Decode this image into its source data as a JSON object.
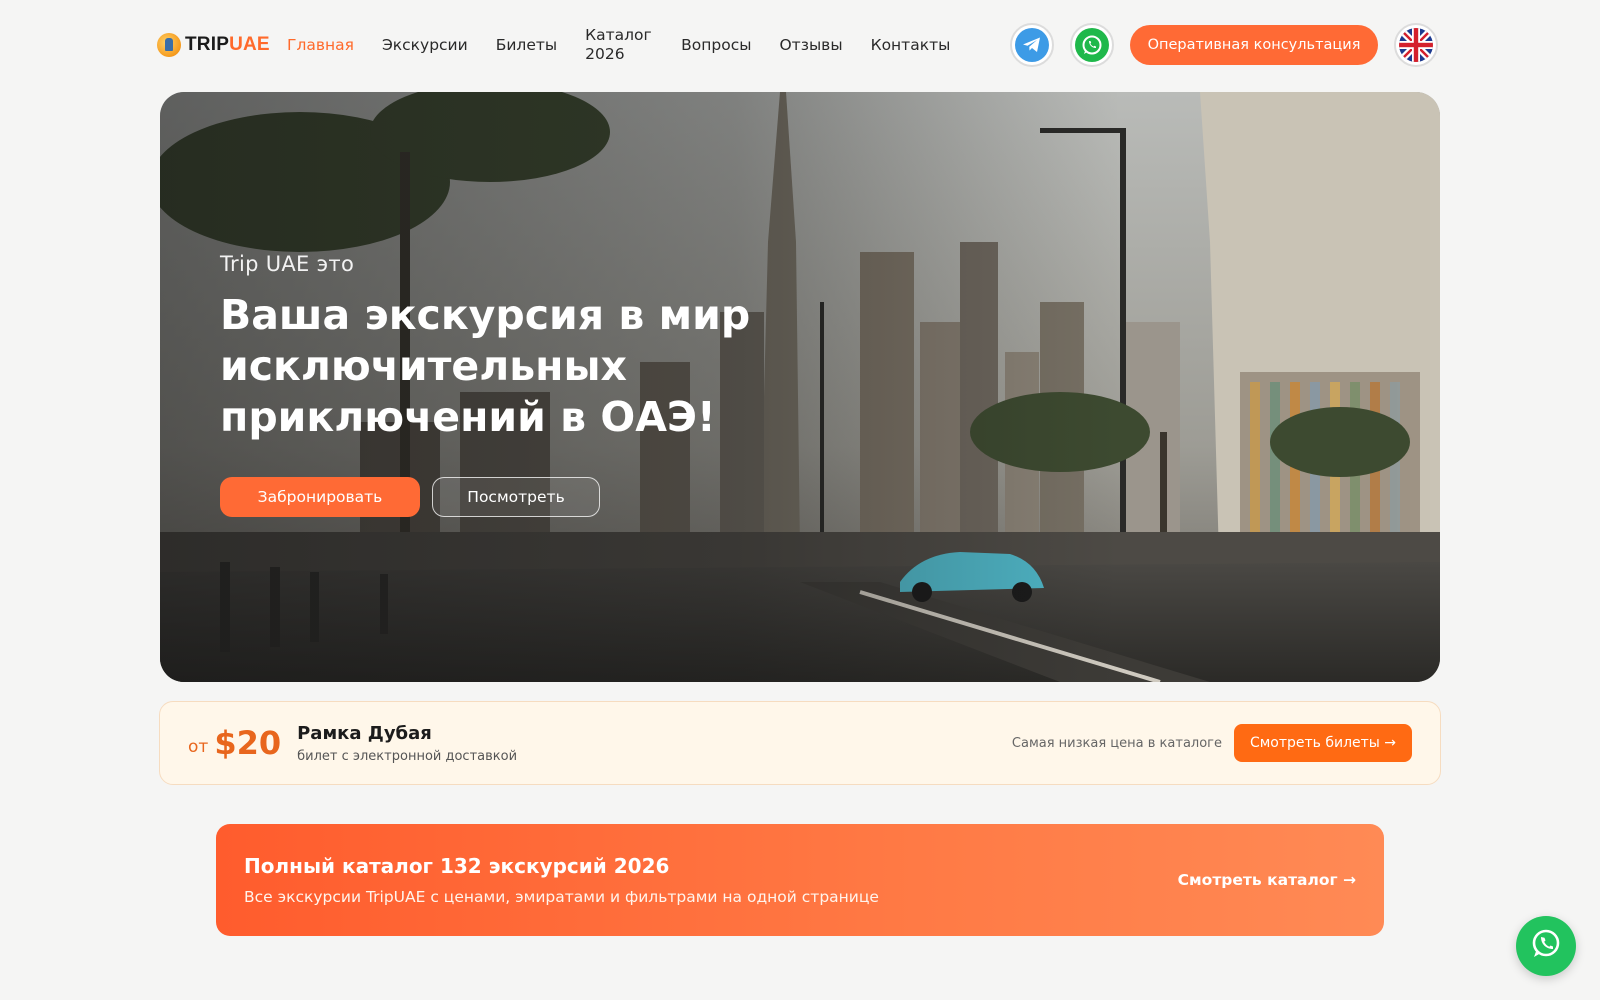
{
  "header": {
    "logo": {
      "part1": "TRIP",
      "part2": "UAE"
    },
    "nav": [
      {
        "label": "Главная",
        "active": true
      },
      {
        "label": "Экскурсии"
      },
      {
        "label": "Билеты"
      },
      {
        "label": "Каталог 2026"
      },
      {
        "label": "Вопросы"
      },
      {
        "label": "Отзывы"
      },
      {
        "label": "Контакты"
      }
    ],
    "telegram_icon": "telegram-icon",
    "whatsapp_icon": "whatsapp-icon",
    "consult_label": "Оперативная консультация",
    "language_icon": "uk-flag-icon"
  },
  "hero": {
    "kicker": "Trip UAE это",
    "title": "Ваша экскурсия в мир исключительных приключений в ОАЭ!",
    "book_label": "Забронировать",
    "view_label": "Посмотреть"
  },
  "price_strip": {
    "from": "от",
    "price": "$20",
    "name": "Рамка Дубая",
    "subtitle": "билет с электронной доставкой",
    "note": "Самая низкая цена в каталоге",
    "button_label": "Смотреть билеты →"
  },
  "catalog": {
    "title": "Полный каталог 132 экскурсий 2026",
    "subtitle": "Все экскурсии TripUAE с ценами, эмиратами и фильтрами на одной странице",
    "link_label": "Смотреть каталог →"
  },
  "colors": {
    "accent": "#ff6a35",
    "accent_text": "#e8661d",
    "telegram": "#3d9be6",
    "whatsapp": "#1fb84b"
  },
  "floating": {
    "icon": "whatsapp-icon"
  }
}
